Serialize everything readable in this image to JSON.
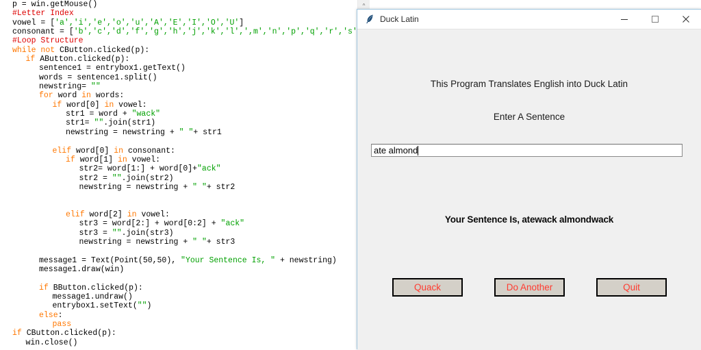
{
  "editor": {
    "name": "python-source-editor",
    "scrollbar": {
      "up_arrow": "^"
    },
    "code_lines": [
      {
        "indent": 0,
        "spans": [
          {
            "t": "p = win.getMouse()",
            "c": "plain"
          }
        ]
      },
      {
        "indent": 0,
        "spans": [
          {
            "t": "#Letter Index",
            "c": "cmt"
          }
        ]
      },
      {
        "indent": 0,
        "spans": [
          {
            "t": "vowel = [",
            "c": "plain"
          },
          {
            "t": "'a','i','e','o','u','A','E','I','O','U'",
            "c": "str"
          },
          {
            "t": "]",
            "c": "plain"
          }
        ]
      },
      {
        "indent": 0,
        "spans": [
          {
            "t": "consonant = [",
            "c": "plain"
          },
          {
            "t": "'b','c','d','f','g','h','j','k','l',',m','n','p','q','r','s','",
            "c": "str"
          }
        ]
      },
      {
        "indent": 0,
        "spans": [
          {
            "t": "#Loop Structure",
            "c": "cmt"
          }
        ]
      },
      {
        "indent": 0,
        "spans": [
          {
            "t": "while",
            "c": "kw"
          },
          {
            "t": " ",
            "c": "plain"
          },
          {
            "t": "not",
            "c": "kw"
          },
          {
            "t": " CButton.clicked(p):",
            "c": "plain"
          }
        ]
      },
      {
        "indent": 1,
        "spans": [
          {
            "t": "if",
            "c": "kw"
          },
          {
            "t": " AButton.clicked(p):",
            "c": "plain"
          }
        ]
      },
      {
        "indent": 2,
        "spans": [
          {
            "t": "sentence1 = entrybox1.getText()",
            "c": "plain"
          }
        ]
      },
      {
        "indent": 2,
        "spans": [
          {
            "t": "words = sentence1.split()",
            "c": "plain"
          }
        ]
      },
      {
        "indent": 2,
        "spans": [
          {
            "t": "newstring= ",
            "c": "plain"
          },
          {
            "t": "\"\"",
            "c": "str"
          }
        ]
      },
      {
        "indent": 2,
        "spans": [
          {
            "t": "for",
            "c": "kw"
          },
          {
            "t": " word ",
            "c": "plain"
          },
          {
            "t": "in",
            "c": "kw"
          },
          {
            "t": " words:",
            "c": "plain"
          }
        ]
      },
      {
        "indent": 3,
        "spans": [
          {
            "t": "if",
            "c": "kw"
          },
          {
            "t": " word[0] ",
            "c": "plain"
          },
          {
            "t": "in",
            "c": "kw"
          },
          {
            "t": " vowel:",
            "c": "plain"
          }
        ]
      },
      {
        "indent": 4,
        "spans": [
          {
            "t": "str1 = word + ",
            "c": "plain"
          },
          {
            "t": "\"wack\"",
            "c": "str"
          }
        ]
      },
      {
        "indent": 4,
        "spans": [
          {
            "t": "str1= ",
            "c": "plain"
          },
          {
            "t": "\"\"",
            "c": "str"
          },
          {
            "t": ".join(str1)",
            "c": "plain"
          }
        ]
      },
      {
        "indent": 4,
        "spans": [
          {
            "t": "newstring = newstring + ",
            "c": "plain"
          },
          {
            "t": "\" \"",
            "c": "str"
          },
          {
            "t": "+ str1",
            "c": "plain"
          }
        ]
      },
      {
        "indent": 0,
        "spans": [
          {
            "t": "",
            "c": "plain"
          }
        ]
      },
      {
        "indent": 3,
        "spans": [
          {
            "t": "elif",
            "c": "kw"
          },
          {
            "t": " word[0] ",
            "c": "plain"
          },
          {
            "t": "in",
            "c": "kw"
          },
          {
            "t": " consonant:",
            "c": "plain"
          }
        ]
      },
      {
        "indent": 4,
        "spans": [
          {
            "t": "if",
            "c": "kw"
          },
          {
            "t": " word[1] ",
            "c": "plain"
          },
          {
            "t": "in",
            "c": "kw"
          },
          {
            "t": " vowel:",
            "c": "plain"
          }
        ]
      },
      {
        "indent": 5,
        "spans": [
          {
            "t": "str2= word[1:] + word[0]+",
            "c": "plain"
          },
          {
            "t": "\"ack\"",
            "c": "str"
          }
        ]
      },
      {
        "indent": 5,
        "spans": [
          {
            "t": "str2 = ",
            "c": "plain"
          },
          {
            "t": "\"\"",
            "c": "str"
          },
          {
            "t": ".join(str2)",
            "c": "plain"
          }
        ]
      },
      {
        "indent": 5,
        "spans": [
          {
            "t": "newstring = newstring + ",
            "c": "plain"
          },
          {
            "t": "\" \"",
            "c": "str"
          },
          {
            "t": "+ str2",
            "c": "plain"
          }
        ]
      },
      {
        "indent": 0,
        "spans": [
          {
            "t": "",
            "c": "plain"
          }
        ]
      },
      {
        "indent": 0,
        "spans": [
          {
            "t": "",
            "c": "plain"
          }
        ]
      },
      {
        "indent": 4,
        "spans": [
          {
            "t": "elif",
            "c": "kw"
          },
          {
            "t": " word[2] ",
            "c": "plain"
          },
          {
            "t": "in",
            "c": "kw"
          },
          {
            "t": " vowel:",
            "c": "plain"
          }
        ]
      },
      {
        "indent": 5,
        "spans": [
          {
            "t": "str3 = word[2:] + word[0:2] + ",
            "c": "plain"
          },
          {
            "t": "\"ack\"",
            "c": "str"
          }
        ]
      },
      {
        "indent": 5,
        "spans": [
          {
            "t": "str3 = ",
            "c": "plain"
          },
          {
            "t": "\"\"",
            "c": "str"
          },
          {
            "t": ".join(str3)",
            "c": "plain"
          }
        ]
      },
      {
        "indent": 5,
        "spans": [
          {
            "t": "newstring = newstring + ",
            "c": "plain"
          },
          {
            "t": "\" \"",
            "c": "str"
          },
          {
            "t": "+ str3",
            "c": "plain"
          }
        ]
      },
      {
        "indent": 0,
        "spans": [
          {
            "t": "",
            "c": "plain"
          }
        ]
      },
      {
        "indent": 2,
        "spans": [
          {
            "t": "message1 = Text(Point(50,50), ",
            "c": "plain"
          },
          {
            "t": "\"Your Sentence Is, \"",
            "c": "str"
          },
          {
            "t": " + newstring)",
            "c": "plain"
          }
        ]
      },
      {
        "indent": 2,
        "spans": [
          {
            "t": "message1.draw(win)",
            "c": "plain"
          }
        ]
      },
      {
        "indent": 0,
        "spans": [
          {
            "t": "",
            "c": "plain"
          }
        ]
      },
      {
        "indent": 2,
        "spans": [
          {
            "t": "if",
            "c": "kw"
          },
          {
            "t": " BButton.clicked(p):",
            "c": "plain"
          }
        ]
      },
      {
        "indent": 3,
        "spans": [
          {
            "t": "message1.undraw()",
            "c": "plain"
          }
        ]
      },
      {
        "indent": 3,
        "spans": [
          {
            "t": "entrybox1.setText(",
            "c": "plain"
          },
          {
            "t": "\"\"",
            "c": "str"
          },
          {
            "t": ")",
            "c": "plain"
          }
        ]
      },
      {
        "indent": 2,
        "spans": [
          {
            "t": "else",
            "c": "kw"
          },
          {
            "t": ":",
            "c": "plain"
          }
        ]
      },
      {
        "indent": 3,
        "spans": [
          {
            "t": "pass",
            "c": "kw"
          }
        ]
      },
      {
        "indent": 0,
        "spans": [
          {
            "t": "if",
            "c": "kw"
          },
          {
            "t": " CButton.clicked(p):",
            "c": "plain"
          }
        ]
      },
      {
        "indent": 1,
        "spans": [
          {
            "t": "win.close()",
            "c": "plain"
          }
        ]
      }
    ],
    "colors": {
      "comment": "#DD0000",
      "keyword": "#FF7700",
      "string": "#00A000",
      "plain": "#000000",
      "background": "#FFFFFF"
    }
  },
  "window": {
    "title": "Duck Latin",
    "icon": "feather-quill-icon",
    "controls": {
      "minimize": "minimize-icon",
      "maximize": "maximize-icon",
      "close": "close-icon"
    },
    "background": "#F0F0F0"
  },
  "app": {
    "heading": "This Program Translates English into Duck Latin",
    "prompt": "Enter A Sentence",
    "entry": {
      "value": "ate almond",
      "placeholder": ""
    },
    "result": "Your Sentence Is,  atewack almondwack",
    "buttons": [
      {
        "label": "Quack",
        "name": "quack-button"
      },
      {
        "label": "Do Another",
        "name": "do-another-button"
      },
      {
        "label": "Quit",
        "name": "quit-button"
      }
    ],
    "colors": {
      "button_text": "#FF3B30",
      "button_face": "#D4D0C8",
      "button_border": "#000000",
      "text": "#1A1A1A"
    }
  }
}
